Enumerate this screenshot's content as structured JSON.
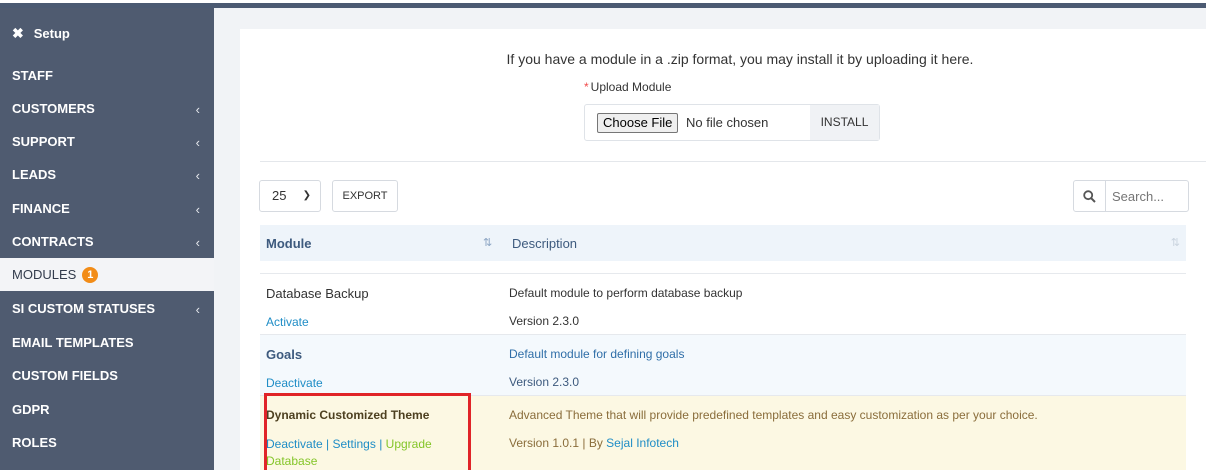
{
  "sidebar": {
    "setup_label": "Setup",
    "items": [
      {
        "label": "STAFF",
        "chevron": false
      },
      {
        "label": "CUSTOMERS",
        "chevron": true
      },
      {
        "label": "SUPPORT",
        "chevron": true
      },
      {
        "label": "LEADS",
        "chevron": true
      },
      {
        "label": "FINANCE",
        "chevron": true
      },
      {
        "label": "CONTRACTS",
        "chevron": true
      },
      {
        "label": "MODULES",
        "chevron": false,
        "active": true,
        "badge": "1"
      },
      {
        "label": "SI CUSTOM STATUSES",
        "chevron": true
      },
      {
        "label": "EMAIL TEMPLATES",
        "chevron": false
      },
      {
        "label": "CUSTOM FIELDS",
        "chevron": false
      },
      {
        "label": "GDPR",
        "chevron": false
      },
      {
        "label": "ROLES",
        "chevron": false
      }
    ],
    "chevron_glyph": "‹"
  },
  "upload": {
    "intro": "If you have a module in a .zip format, you may install it by uploading it here.",
    "required_mark": "*",
    "label": "Upload Module",
    "choose_file": "Choose File",
    "no_file": "No file chosen",
    "install": "INSTALL"
  },
  "toolbar": {
    "page_size": "25",
    "export": "EXPORT",
    "search_placeholder": "Search..."
  },
  "table": {
    "headers": {
      "module": "Module",
      "description": "Description"
    },
    "rows": [
      {
        "name": "Database Backup",
        "actions": [
          "Activate"
        ],
        "description": "Default module to perform database backup",
        "version": "Version 2.3.0"
      },
      {
        "name": "Goals",
        "actions": [
          "Deactivate"
        ],
        "description": "Default module for defining goals",
        "version": "Version 2.3.0"
      },
      {
        "name": "Dynamic Customized Theme",
        "actions": [
          "Deactivate",
          "Settings",
          "Upgrade Database"
        ],
        "description": "Advanced Theme that will provide predefined templates and easy customization as per your choice.",
        "version_prefix": "Version 1.0.1 | By ",
        "author": "Sejal Infotech"
      }
    ],
    "separator": " | "
  },
  "colors": {
    "sidebar_bg": "#4f5b70",
    "link_blue": "#1f8dc6",
    "link_green": "#84c529",
    "badge_orange": "#f28c18",
    "highlight_red": "#e02428"
  }
}
